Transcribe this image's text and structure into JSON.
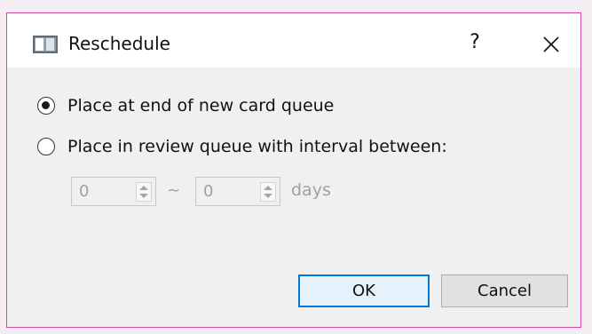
{
  "dialog": {
    "title": "Reschedule",
    "help_label": "?",
    "icons": {
      "app": "window-app-icon",
      "close": "close-icon"
    }
  },
  "options": [
    {
      "label": "Place at end of new card queue",
      "selected": true
    },
    {
      "label": "Place in review queue with interval between:",
      "selected": false
    }
  ],
  "interval": {
    "min_value": "0",
    "separator": "~",
    "max_value": "0",
    "unit": "days",
    "enabled": false
  },
  "buttons": {
    "ok": "OK",
    "cancel": "Cancel"
  },
  "colors": {
    "accent": "#0078d7",
    "window_border": "#d24aa6",
    "disabled_text": "#a0a0a0"
  }
}
